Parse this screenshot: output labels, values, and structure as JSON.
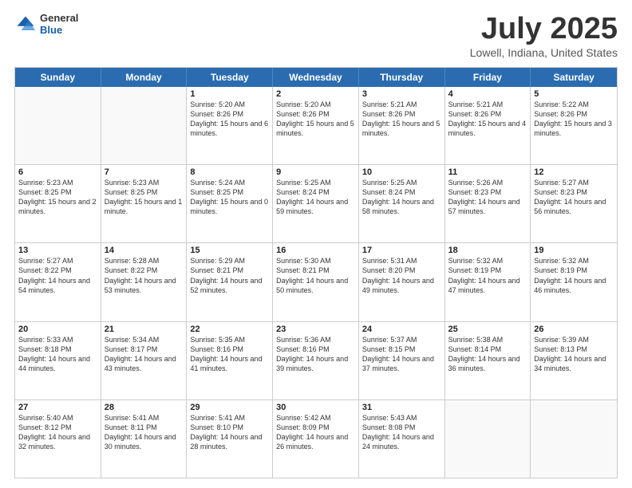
{
  "header": {
    "logo_general": "General",
    "logo_blue": "Blue",
    "title": "July 2025",
    "location": "Lowell, Indiana, United States"
  },
  "calendar": {
    "days_of_week": [
      "Sunday",
      "Monday",
      "Tuesday",
      "Wednesday",
      "Thursday",
      "Friday",
      "Saturday"
    ],
    "rows": [
      [
        {
          "day": "",
          "sunrise": "",
          "sunset": "",
          "daylight": ""
        },
        {
          "day": "",
          "sunrise": "",
          "sunset": "",
          "daylight": ""
        },
        {
          "day": "1",
          "sunrise": "Sunrise: 5:20 AM",
          "sunset": "Sunset: 8:26 PM",
          "daylight": "Daylight: 15 hours and 6 minutes."
        },
        {
          "day": "2",
          "sunrise": "Sunrise: 5:20 AM",
          "sunset": "Sunset: 8:26 PM",
          "daylight": "Daylight: 15 hours and 5 minutes."
        },
        {
          "day": "3",
          "sunrise": "Sunrise: 5:21 AM",
          "sunset": "Sunset: 8:26 PM",
          "daylight": "Daylight: 15 hours and 5 minutes."
        },
        {
          "day": "4",
          "sunrise": "Sunrise: 5:21 AM",
          "sunset": "Sunset: 8:26 PM",
          "daylight": "Daylight: 15 hours and 4 minutes."
        },
        {
          "day": "5",
          "sunrise": "Sunrise: 5:22 AM",
          "sunset": "Sunset: 8:26 PM",
          "daylight": "Daylight: 15 hours and 3 minutes."
        }
      ],
      [
        {
          "day": "6",
          "sunrise": "Sunrise: 5:23 AM",
          "sunset": "Sunset: 8:25 PM",
          "daylight": "Daylight: 15 hours and 2 minutes."
        },
        {
          "day": "7",
          "sunrise": "Sunrise: 5:23 AM",
          "sunset": "Sunset: 8:25 PM",
          "daylight": "Daylight: 15 hours and 1 minute."
        },
        {
          "day": "8",
          "sunrise": "Sunrise: 5:24 AM",
          "sunset": "Sunset: 8:25 PM",
          "daylight": "Daylight: 15 hours and 0 minutes."
        },
        {
          "day": "9",
          "sunrise": "Sunrise: 5:25 AM",
          "sunset": "Sunset: 8:24 PM",
          "daylight": "Daylight: 14 hours and 59 minutes."
        },
        {
          "day": "10",
          "sunrise": "Sunrise: 5:25 AM",
          "sunset": "Sunset: 8:24 PM",
          "daylight": "Daylight: 14 hours and 58 minutes."
        },
        {
          "day": "11",
          "sunrise": "Sunrise: 5:26 AM",
          "sunset": "Sunset: 8:23 PM",
          "daylight": "Daylight: 14 hours and 57 minutes."
        },
        {
          "day": "12",
          "sunrise": "Sunrise: 5:27 AM",
          "sunset": "Sunset: 8:23 PM",
          "daylight": "Daylight: 14 hours and 56 minutes."
        }
      ],
      [
        {
          "day": "13",
          "sunrise": "Sunrise: 5:27 AM",
          "sunset": "Sunset: 8:22 PM",
          "daylight": "Daylight: 14 hours and 54 minutes."
        },
        {
          "day": "14",
          "sunrise": "Sunrise: 5:28 AM",
          "sunset": "Sunset: 8:22 PM",
          "daylight": "Daylight: 14 hours and 53 minutes."
        },
        {
          "day": "15",
          "sunrise": "Sunrise: 5:29 AM",
          "sunset": "Sunset: 8:21 PM",
          "daylight": "Daylight: 14 hours and 52 minutes."
        },
        {
          "day": "16",
          "sunrise": "Sunrise: 5:30 AM",
          "sunset": "Sunset: 8:21 PM",
          "daylight": "Daylight: 14 hours and 50 minutes."
        },
        {
          "day": "17",
          "sunrise": "Sunrise: 5:31 AM",
          "sunset": "Sunset: 8:20 PM",
          "daylight": "Daylight: 14 hours and 49 minutes."
        },
        {
          "day": "18",
          "sunrise": "Sunrise: 5:32 AM",
          "sunset": "Sunset: 8:19 PM",
          "daylight": "Daylight: 14 hours and 47 minutes."
        },
        {
          "day": "19",
          "sunrise": "Sunrise: 5:32 AM",
          "sunset": "Sunset: 8:19 PM",
          "daylight": "Daylight: 14 hours and 46 minutes."
        }
      ],
      [
        {
          "day": "20",
          "sunrise": "Sunrise: 5:33 AM",
          "sunset": "Sunset: 8:18 PM",
          "daylight": "Daylight: 14 hours and 44 minutes."
        },
        {
          "day": "21",
          "sunrise": "Sunrise: 5:34 AM",
          "sunset": "Sunset: 8:17 PM",
          "daylight": "Daylight: 14 hours and 43 minutes."
        },
        {
          "day": "22",
          "sunrise": "Sunrise: 5:35 AM",
          "sunset": "Sunset: 8:16 PM",
          "daylight": "Daylight: 14 hours and 41 minutes."
        },
        {
          "day": "23",
          "sunrise": "Sunrise: 5:36 AM",
          "sunset": "Sunset: 8:16 PM",
          "daylight": "Daylight: 14 hours and 39 minutes."
        },
        {
          "day": "24",
          "sunrise": "Sunrise: 5:37 AM",
          "sunset": "Sunset: 8:15 PM",
          "daylight": "Daylight: 14 hours and 37 minutes."
        },
        {
          "day": "25",
          "sunrise": "Sunrise: 5:38 AM",
          "sunset": "Sunset: 8:14 PM",
          "daylight": "Daylight: 14 hours and 36 minutes."
        },
        {
          "day": "26",
          "sunrise": "Sunrise: 5:39 AM",
          "sunset": "Sunset: 8:13 PM",
          "daylight": "Daylight: 14 hours and 34 minutes."
        }
      ],
      [
        {
          "day": "27",
          "sunrise": "Sunrise: 5:40 AM",
          "sunset": "Sunset: 8:12 PM",
          "daylight": "Daylight: 14 hours and 32 minutes."
        },
        {
          "day": "28",
          "sunrise": "Sunrise: 5:41 AM",
          "sunset": "Sunset: 8:11 PM",
          "daylight": "Daylight: 14 hours and 30 minutes."
        },
        {
          "day": "29",
          "sunrise": "Sunrise: 5:41 AM",
          "sunset": "Sunset: 8:10 PM",
          "daylight": "Daylight: 14 hours and 28 minutes."
        },
        {
          "day": "30",
          "sunrise": "Sunrise: 5:42 AM",
          "sunset": "Sunset: 8:09 PM",
          "daylight": "Daylight: 14 hours and 26 minutes."
        },
        {
          "day": "31",
          "sunrise": "Sunrise: 5:43 AM",
          "sunset": "Sunset: 8:08 PM",
          "daylight": "Daylight: 14 hours and 24 minutes."
        },
        {
          "day": "",
          "sunrise": "",
          "sunset": "",
          "daylight": ""
        },
        {
          "day": "",
          "sunrise": "",
          "sunset": "",
          "daylight": ""
        }
      ]
    ]
  }
}
